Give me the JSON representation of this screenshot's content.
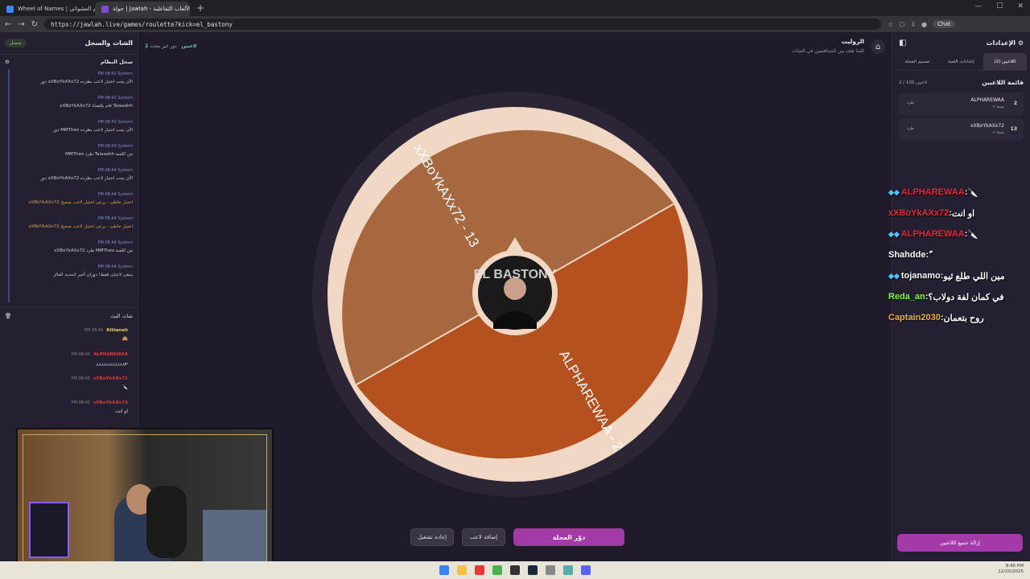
{
  "browser": {
    "tabs": [
      {
        "title": "Wheel of Names | الاسم العشوائي",
        "active": false,
        "color": "#4285f4"
      },
      {
        "title": "جولة | Jawlah - منصة الألعاب التفاعلية",
        "active": true,
        "color": "#7b4fd0"
      }
    ],
    "new_tab": "+",
    "url": "https://jawlah.live/games/roulette?kick=el_bastony",
    "chat_button": "Chat"
  },
  "left_panel": {
    "title": "الشات والسجل",
    "connection": "متصل",
    "system_log_title": "سجل النظام",
    "system_log": [
      {
        "meta": "PM 08:41 System",
        "text": "دور xXBoYkAXx72 الآن يجب اختيار لاعب بطرده",
        "warn": false
      },
      {
        "meta": "PM 08:41 System",
        "text": "xXBoYkAXx72 قام بإقصاء Talaaahh",
        "warn": false
      },
      {
        "meta": "PM 08:43 System",
        "text": "دور MMTheo الآن يجب اختيار لاعب بطرده",
        "warn": false
      },
      {
        "meta": "PM 08:43 System",
        "text": "MMTheo طرد Talaaahh من اللعبة",
        "warn": false
      },
      {
        "meta": "PM 08:44 System",
        "text": "دور xXBoYkAXx72 الآن يجب اختيار لاعب بطرده",
        "warn": false
      },
      {
        "meta": "PM 08:44 System",
        "text": "xXBoYkAXx72 اختيار خاطئ - يرجى اختيار لاعب صحيح",
        "warn": true
      },
      {
        "meta": "PM 08:44 System",
        "text": "xXBoYkAXx72 اختيار خاطئ - يرجى اختيار لاعب صحيح",
        "warn": true
      },
      {
        "meta": "PM 08:44 System",
        "text": "xXBoYkAXx72 طرد MMTheo من اللعبة",
        "warn": false
      },
      {
        "meta": "PM 08:44 System",
        "text": "يتبقى لاعبان فقط! دوران أخير لتحديد الفائز",
        "warn": false
      }
    ],
    "live_chat_title": "شات البث",
    "live_chat": [
      {
        "user": "Kittaneh",
        "time": "PM 08:45",
        "msg": "🙈",
        "color": "#f0d060"
      },
      {
        "user": "ALPHAREWAA",
        "time": "PM 08:45",
        "msg": "نورررررررررررر",
        "color": "#e03a3a"
      },
      {
        "user": "xXBoYkAXx72",
        "time": "PM 08:45",
        "msg": "🔪",
        "color": "#e03a3a"
      },
      {
        "user": "xXBoYkAXx72",
        "time": "PM 08:45",
        "msg": "او انت",
        "color": "#e03a3a"
      }
    ]
  },
  "center": {
    "players_count": "2 لاعبين",
    "turn_text": "دور غير محدد",
    "game_title": "الروليت",
    "game_subtitle": "كلما تقف بين المتنافسين في الشات",
    "wheel": {
      "segments": [
        {
          "label": "xXBoYkAXx72 - 13",
          "color": "#a8683f"
        },
        {
          "label": "ALPHAREWAA - 2",
          "color": "#b5511f"
        }
      ],
      "center_text": "EL BASTONY"
    },
    "buttons": {
      "restart": "إعادة تشغيل",
      "add_player": "إضافة لاعب",
      "spin": "دوّر العجلة"
    }
  },
  "right_panel": {
    "title": "الإعدادات",
    "tabs": [
      "اللاعبين (2)",
      "إعدادات اللعبة",
      "تصميم العجلة"
    ],
    "list_title": "قائمة اللاعبين",
    "list_count": "2 / 100 لاعبين",
    "players": [
      {
        "number": "2",
        "name": "ALPHAREWAA",
        "status": "✔ نشط",
        "kick": "طرد"
      },
      {
        "number": "13",
        "name": "xXBoYkAXx72",
        "status": "✔ نشط",
        "kick": "طرد"
      }
    ],
    "remove_all": "إزالة جميع اللاعبين"
  },
  "overlay_chat": [
    {
      "badges": "◆◆",
      "user": "ALPHAREWAA",
      "sep": " : ",
      "msg": "🔪",
      "color": "#e8283a"
    },
    {
      "badges": "",
      "user": "xXBoYkAXx72",
      "sep": " : ",
      "msg": "او انت",
      "color": "#e8283a"
    },
    {
      "badges": "◆◆",
      "user": "ALPHAREWAA",
      "sep": " : ",
      "msg": "🔪",
      "color": "#e8283a"
    },
    {
      "badges": "",
      "user": "Shahdde",
      "sep": " : ",
      "msg": "ً",
      "color": "#ffffff"
    },
    {
      "badges": "◆◆",
      "user": "tojanamo",
      "sep": " : ",
      "msg": "مين اللي طلع ثيو",
      "color": "#ffffff"
    },
    {
      "badges": "",
      "user": "Reda_an",
      "sep": " : ",
      "msg": "في كمان لفة دولاب؟",
      "color": "#7dff3a"
    },
    {
      "badges": "",
      "user": "Captain2030",
      "sep": " : ",
      "msg": "روح بتعمان",
      "color": "#f0b030"
    }
  ],
  "taskbar": {
    "time": "8:45 PM",
    "date": "12/20/2025"
  }
}
